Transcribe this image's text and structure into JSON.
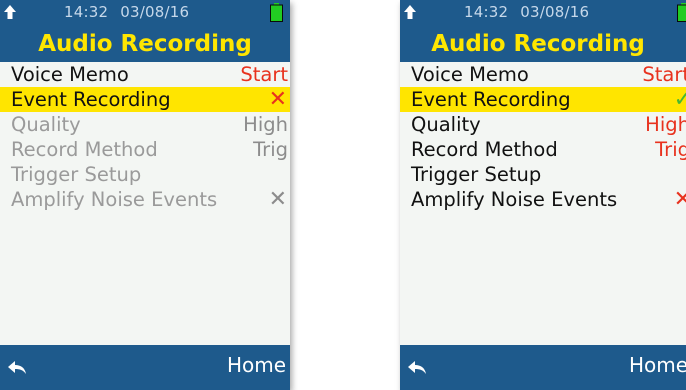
{
  "colors": {
    "bar_blue": "#1e5a8c",
    "title_yellow": "#ffe600",
    "selected_row": "#ffe500",
    "value_red": "#e8321e",
    "check_green": "#47b832",
    "disabled_grey": "#9a9a9a",
    "battery_green": "#22cc22"
  },
  "screens": [
    {
      "status": {
        "time": "14:32",
        "date": "03/08/16",
        "battery_icon": "battery-full-icon",
        "left_icon": "up-arrow-icon"
      },
      "title": "Audio Recording",
      "menu": [
        {
          "label": "Voice Memo",
          "value": "Start",
          "state": "enabled",
          "value_style": "red"
        },
        {
          "label": "Event Recording",
          "value": "✕",
          "icon": "cross-icon",
          "state": "selected",
          "value_style": "red"
        },
        {
          "label": "Quality",
          "value": "High",
          "state": "disabled",
          "value_style": "grey"
        },
        {
          "label": "Record Method",
          "value": "Trig",
          "state": "disabled",
          "value_style": "grey"
        },
        {
          "label": "Trigger Setup",
          "value": "",
          "state": "disabled",
          "value_style": "grey"
        },
        {
          "label": "Amplify Noise Events",
          "value": "✕",
          "icon": "cross-icon",
          "state": "disabled",
          "value_style": "grey"
        }
      ],
      "footer": {
        "back_icon": "back-arrow-icon",
        "home_label": "Home"
      }
    },
    {
      "status": {
        "time": "14:32",
        "date": "03/08/16",
        "battery_icon": "battery-full-icon",
        "left_icon": "up-arrow-icon"
      },
      "title": "Audio Recording",
      "menu": [
        {
          "label": "Voice Memo",
          "value": "Start",
          "state": "enabled",
          "value_style": "red"
        },
        {
          "label": "Event Recording",
          "value": "✓",
          "icon": "check-icon",
          "state": "selected",
          "value_style": "green"
        },
        {
          "label": "Quality",
          "value": "High",
          "state": "enabled",
          "value_style": "red"
        },
        {
          "label": "Record Method",
          "value": "Trig",
          "state": "enabled",
          "value_style": "red"
        },
        {
          "label": "Trigger Setup",
          "value": "",
          "state": "enabled",
          "value_style": "red"
        },
        {
          "label": "Amplify Noise Events",
          "value": "✕",
          "icon": "cross-icon",
          "state": "enabled",
          "value_style": "red"
        }
      ],
      "footer": {
        "back_icon": "back-arrow-icon",
        "home_label": "Home"
      }
    }
  ]
}
